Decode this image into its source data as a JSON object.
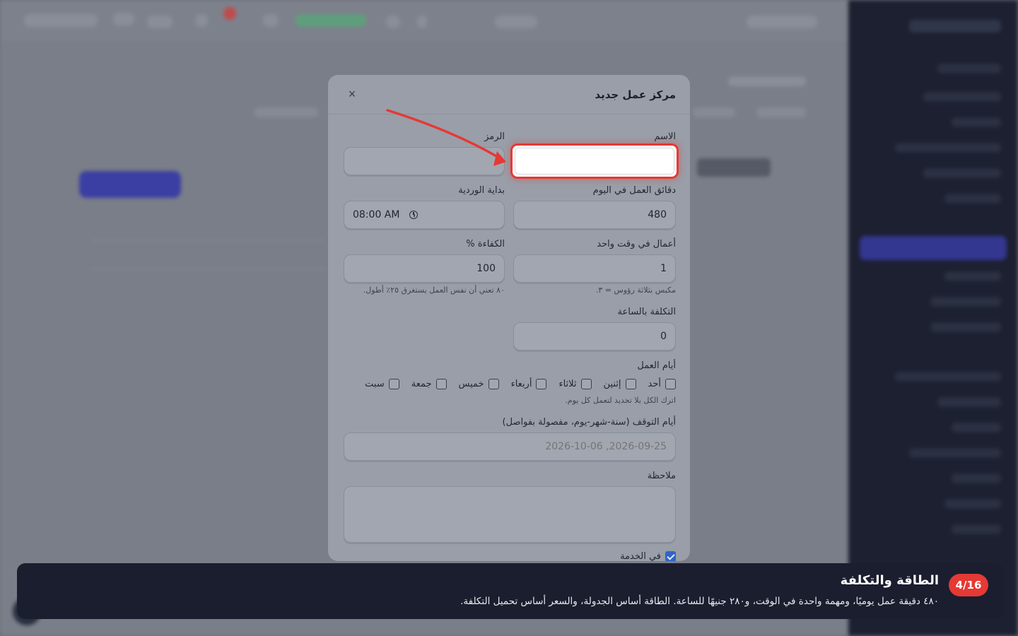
{
  "modal": {
    "title": "مركز عمل جديد",
    "close_glyph": "×",
    "fields": {
      "name_label": "الاسم",
      "code_label": "الرمز",
      "minutes_label": "دقائق العمل في اليوم",
      "minutes_value": "480",
      "shift_start_label": "بداية الوردية",
      "shift_start_value": "08:00 AM",
      "concurrent_label": "أعمال في وقت واحد",
      "concurrent_value": "1",
      "concurrent_hint": "مكبس بثلاثة رؤوس = ٣.",
      "efficiency_label": "الكفاءة %",
      "efficiency_value": "100",
      "efficiency_hint": "٨٠ تعني أن نفس العمل يستغرق ٢٥٪ أطول.",
      "hourly_cost_label": "التكلفة بالساعة",
      "hourly_cost_value": "0",
      "workdays_label": "أيام العمل",
      "workdays_hint": "اترك الكل بلا تحديد لتعمل كل يوم.",
      "downtime_label": "أيام التوقف (سنة-شهر-يوم، مفصولة بفواصل)",
      "downtime_placeholder": "2026-09-25, 2026-10-06",
      "note_label": "ملاحظة",
      "in_service_label": "في الخدمة"
    },
    "days": [
      {
        "label": "أحد"
      },
      {
        "label": "إثنين"
      },
      {
        "label": "ثلاثاء"
      },
      {
        "label": "أربعاء"
      },
      {
        "label": "خميس"
      },
      {
        "label": "جمعة"
      },
      {
        "label": "سبت"
      }
    ]
  },
  "tour": {
    "step": "4/16",
    "title": "الطاقة والتكلفة",
    "description": "٤٨٠ دقيقة عمل يوميًا، ومهمة واحدة في الوقت، و٢٨٠ جنيهًا للساعة. الطاقة أساس الجدولة، والسعر أساس تحميل التكلفة."
  },
  "colors": {
    "highlight": "#e53935",
    "tour_bg": "#1a1e2e",
    "step_badge": "#e53935",
    "checkbox_checked": "#2f64c8"
  }
}
